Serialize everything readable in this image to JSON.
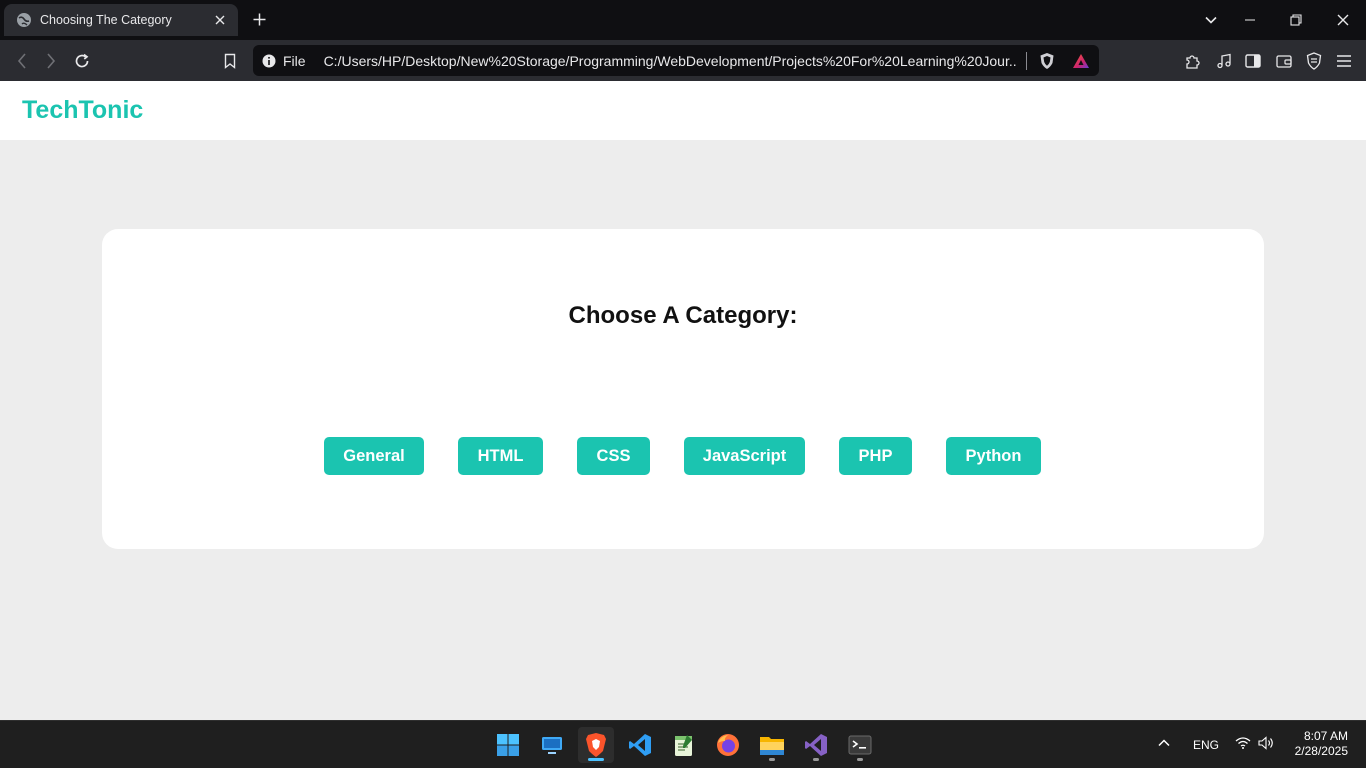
{
  "browser": {
    "tab_title": "Choosing The Category",
    "url_scheme": "File",
    "url": "C:/Users/HP/Desktop/New%20Storage/Programming/WebDevelopment/Projects%20For%20Learning%20Jour..."
  },
  "page": {
    "logo": "TechTonic",
    "heading": "Choose A Category:",
    "categories": [
      "General",
      "HTML",
      "CSS",
      "JavaScript",
      "PHP",
      "Python"
    ]
  },
  "taskbar": {
    "language": "ENG",
    "time": "8:07 AM",
    "date": "2/28/2025"
  },
  "colors": {
    "accent": "#1bc4b0",
    "page_bg": "#ededed",
    "card_bg": "#ffffff",
    "chrome_dark": "#0f0f12",
    "chrome_toolbar": "#2b2c31"
  },
  "icons": {
    "tab": [
      "globe-icon",
      "close-icon",
      "plus-icon"
    ],
    "window": [
      "chevron-down-icon",
      "minimize-icon",
      "restore-icon",
      "close-icon"
    ],
    "toolbar": [
      "back-icon",
      "forward-icon",
      "reload-icon",
      "bookmark-icon",
      "info-icon",
      "brave-shield-icon",
      "brave-rewards-icon",
      "extensions-icon",
      "media-icon",
      "sidebar-icon",
      "wallet-icon",
      "vpn-icon",
      "menu-icon"
    ],
    "taskbar": [
      "windows-start-icon",
      "desktop-icon",
      "brave-icon",
      "vscode-icon",
      "notepad-icon",
      "firefox-icon",
      "file-explorer-icon",
      "visual-studio-icon",
      "terminal-icon",
      "chevron-up-icon",
      "wifi-icon",
      "volume-icon"
    ]
  }
}
